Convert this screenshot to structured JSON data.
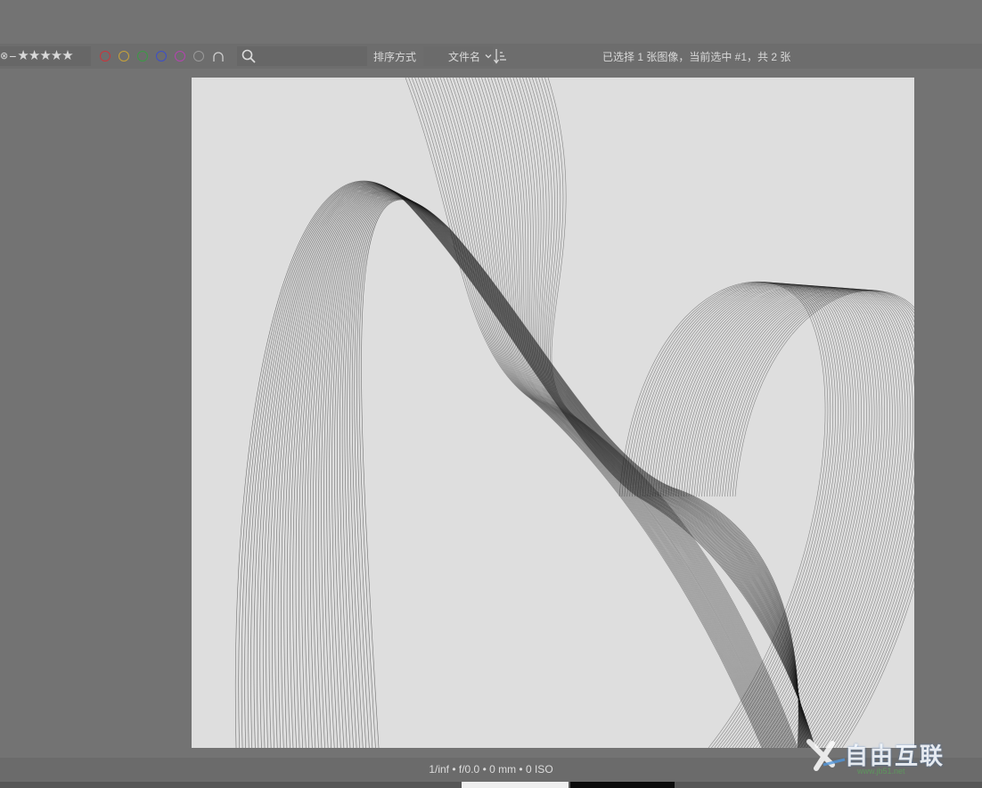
{
  "toolbar": {
    "rating": {
      "reject": "⊗",
      "clear": "−",
      "stars": [
        "★",
        "★",
        "★",
        "★",
        "★"
      ]
    },
    "color_labels": [
      {
        "name": "red",
        "color": "#c8363d"
      },
      {
        "name": "yellow",
        "color": "#c7a23a"
      },
      {
        "name": "green",
        "color": "#3b9a45"
      },
      {
        "name": "blue",
        "color": "#3d4fc8"
      },
      {
        "name": "purple",
        "color": "#b444b0"
      },
      {
        "name": "gray",
        "color": "#9a9a9a"
      }
    ],
    "search": {
      "placeholder": "",
      "value": ""
    },
    "sort_label": "排序方式",
    "sort_value": "文件名",
    "status": "已选择 1 张图像，当前选中 #1，共 2 张"
  },
  "viewer": {
    "background": "#dedede",
    "line_color": "#1a1a1a"
  },
  "bottom_bar": {
    "exif": "1/inf • f/0.0 • 0 mm • 0 ISO"
  },
  "watermark": {
    "text": "自由互联",
    "url": "www.jb51.net"
  }
}
